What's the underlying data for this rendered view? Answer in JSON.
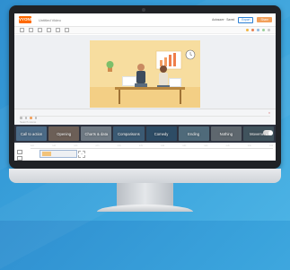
{
  "header": {
    "logo": "VYOND",
    "doc_title": "Untitled Video",
    "save_status": "Autosave · Saved",
    "export_label": "Export",
    "publish_label": "Share"
  },
  "scene_search": {
    "placeholder": "Search scene"
  },
  "scenes": [
    {
      "label": "Call to action",
      "color": "#4b6a86"
    },
    {
      "label": "Opening",
      "color": "#6c5f57"
    },
    {
      "label": "Charts & data",
      "color": "#6f7a84"
    },
    {
      "label": "Comparisons",
      "color": "#3b5a73"
    },
    {
      "label": "Comedy",
      "color": "#2d4c65"
    },
    {
      "label": "Ending",
      "color": "#4f6a7a"
    },
    {
      "label": "Nothing",
      "color": "#5e676e"
    },
    {
      "label": "Movement",
      "color": "#40535d"
    }
  ],
  "timeline": {
    "ticks": [
      "0:00",
      "0:05",
      "0:10",
      "0:15",
      "0:20",
      "0:25",
      "0:30",
      "0:35",
      "0:40",
      "0:45",
      "0:50",
      "0:55"
    ]
  },
  "colors": {
    "background": "#3aa3dc",
    "accent": "#ff6a00",
    "canvas_scene": "#f7dd9f",
    "strip": "#2e3340"
  }
}
